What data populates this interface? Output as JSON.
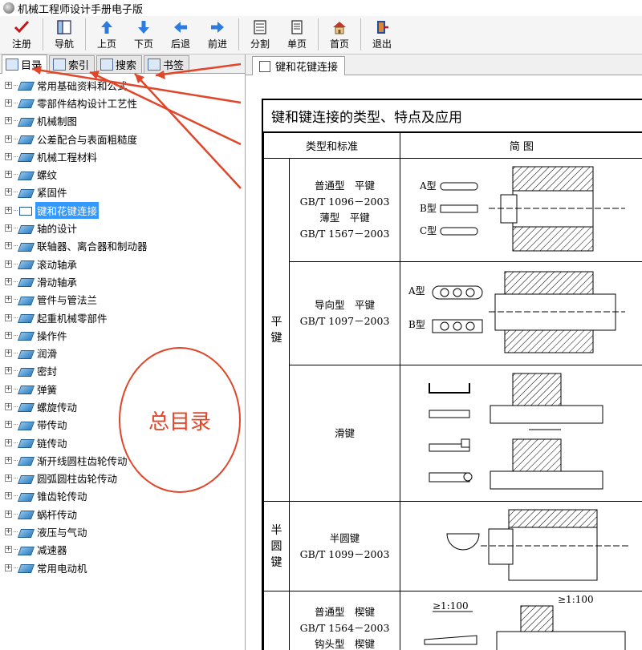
{
  "window": {
    "title": "机械工程师设计手册电子版"
  },
  "toolbar": {
    "buttons": [
      {
        "label": "注册",
        "icon": "checkmark-icon"
      },
      {
        "label": "导航",
        "icon": "navigation-icon"
      },
      {
        "label": "上页",
        "icon": "arrow-up-icon"
      },
      {
        "label": "下页",
        "icon": "arrow-down-icon"
      },
      {
        "label": "后退",
        "icon": "arrow-left-icon"
      },
      {
        "label": "前进",
        "icon": "arrow-right-icon"
      },
      {
        "label": "分割",
        "icon": "split-icon"
      },
      {
        "label": "单页",
        "icon": "single-page-icon"
      },
      {
        "label": "首页",
        "icon": "home-icon"
      },
      {
        "label": "退出",
        "icon": "exit-icon"
      }
    ]
  },
  "left_tabs": [
    {
      "label": "目录"
    },
    {
      "label": "索引"
    },
    {
      "label": "搜索"
    },
    {
      "label": "书签"
    }
  ],
  "tree": [
    "常用基础资料和公式",
    "零部件结构设计工艺性",
    "机械制图",
    "公差配合与表面粗糙度",
    "机械工程材料",
    "螺纹",
    "紧固件",
    "键和花键连接",
    "轴的设计",
    "联轴器、离合器和制动器",
    "滚动轴承",
    "滑动轴承",
    "管件与管法兰",
    "起重机械零部件",
    "操作件",
    "润滑",
    "密封",
    "弹簧",
    "螺旋传动",
    "带传动",
    "链传动",
    "渐开线圆柱齿轮传动",
    "圆弧圆柱齿轮传动",
    "锥齿轮传动",
    "蜗杆传动",
    "液压与气动",
    "减速器",
    "常用电动机"
  ],
  "tree_selected": "键和花键连接",
  "annotation": {
    "circle_text": "总目录"
  },
  "right_tab": {
    "label": "键和花键连接"
  },
  "document": {
    "title": "键和键连接的类型、特点及应用",
    "col_type": "类型和标准",
    "col_figure": "简 图",
    "cat_flat": "平\n键",
    "cat_semi": "半\n圆\n键",
    "row1": {
      "l1": "普通型　平键",
      "l2": "GB/T 1096－2003",
      "l3": "薄型　平键",
      "l4": "GB/T 1567－2003",
      "ta": "A型",
      "tb": "B型",
      "tc": "C型"
    },
    "row2": {
      "l1": "导向型　平键",
      "l2": "GB/T 1097－2003",
      "ta": "A型",
      "tb": "B型"
    },
    "row3": {
      "l1": "滑键"
    },
    "row4": {
      "l1": "半圆键",
      "l2": "GB/T 1099－2003"
    },
    "row5": {
      "l1": "普通型　楔键",
      "l2": "GB/T 1564－2003",
      "l3": "钩头型　楔键",
      "slope1": "≥1:100",
      "slope2": "≥1:100"
    }
  }
}
